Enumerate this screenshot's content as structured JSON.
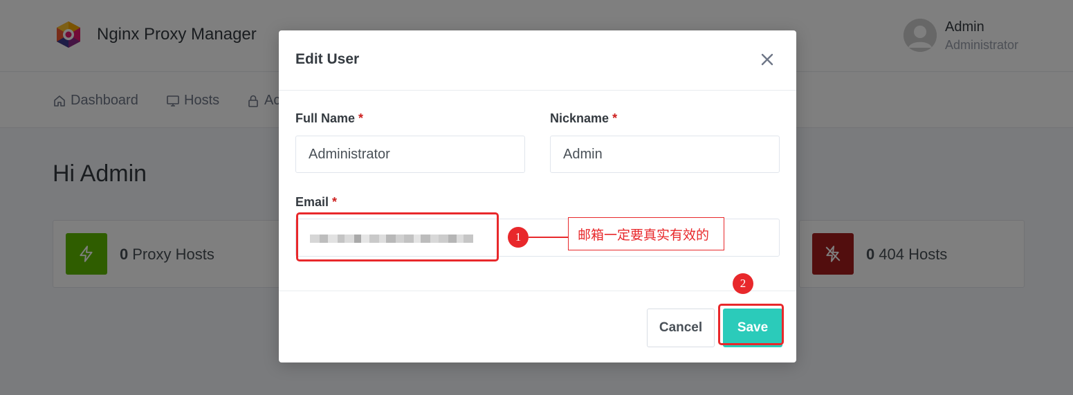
{
  "app": {
    "brand_name": "Nginx Proxy Manager",
    "user": {
      "name": "Admin",
      "role": "Administrator"
    },
    "nav": [
      {
        "label": "Dashboard",
        "icon": "home-icon"
      },
      {
        "label": "Hosts",
        "icon": "monitor-icon"
      },
      {
        "label": "Ac",
        "icon": "lock-icon"
      }
    ],
    "greeting": "Hi Admin",
    "stats": [
      {
        "count": "0",
        "label": "Proxy Hosts",
        "color": "#5eba00",
        "icon": "bolt-icon"
      },
      {
        "count": "0",
        "label": "404 Hosts",
        "color": "#a41d1d",
        "icon": "zap-off-icon"
      }
    ]
  },
  "modal": {
    "title": "Edit User",
    "full_name": {
      "label": "Full Name",
      "required": "*",
      "value": "Administrator"
    },
    "nickname": {
      "label": "Nickname",
      "required": "*",
      "value": "Admin"
    },
    "email": {
      "label": "Email",
      "required": "*"
    },
    "cancel_label": "Cancel",
    "save_label": "Save"
  },
  "annotations": {
    "badge_1": "1",
    "badge_2": "2",
    "callout": "邮箱一定要真实有效的",
    "color": "#e8282b"
  },
  "colors": {
    "overlay": "rgba(0,0,0,0.5)",
    "save_button": "#2bcbba",
    "required_star": "#cd201f"
  }
}
